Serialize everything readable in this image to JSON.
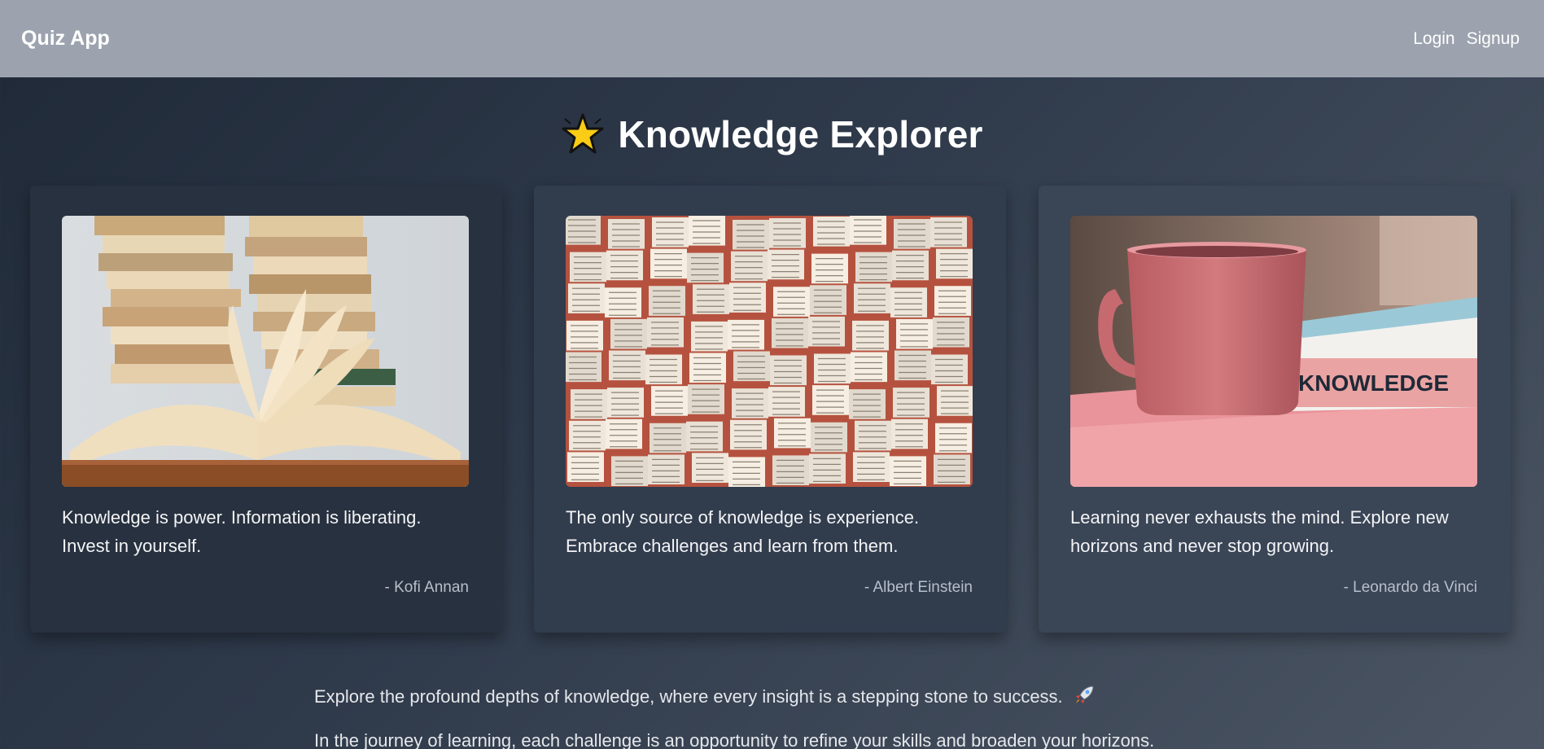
{
  "navbar": {
    "brand": "Quiz App",
    "login_label": "Login",
    "signup_label": "Signup"
  },
  "header": {
    "icon": "star-icon",
    "title": "Knowledge Explorer"
  },
  "cards": [
    {
      "image": "open-book-stack-photo",
      "quote": "Knowledge is power. Information is liberating. Invest in yourself.",
      "author": "- Kofi Annan"
    },
    {
      "image": "book-pages-collage-photo",
      "quote": "The only source of knowledge is experience. Embrace challenges and learn from them.",
      "author": "- Albert Einstein"
    },
    {
      "image": "pink-mug-knowledge-book-photo",
      "image_text": "KNOWLEDGE",
      "quote": "Learning never exhausts the mind. Explore new horizons and never stop growing.",
      "author": "- Leonardo da Vinci"
    }
  ],
  "intro": {
    "line1": "Explore the profound depths of knowledge, where every insight is a stepping stone to success.",
    "line1_icon": "rocket-icon",
    "line2": "In the journey of learning, each challenge is an opportunity to refine your skills and broaden your horizons."
  },
  "colors": {
    "navbar": "#9ca3af",
    "background_start": "#1f2937",
    "background_end": "#4b5563",
    "card": "#313c4d",
    "accent_star": "#facc15"
  }
}
